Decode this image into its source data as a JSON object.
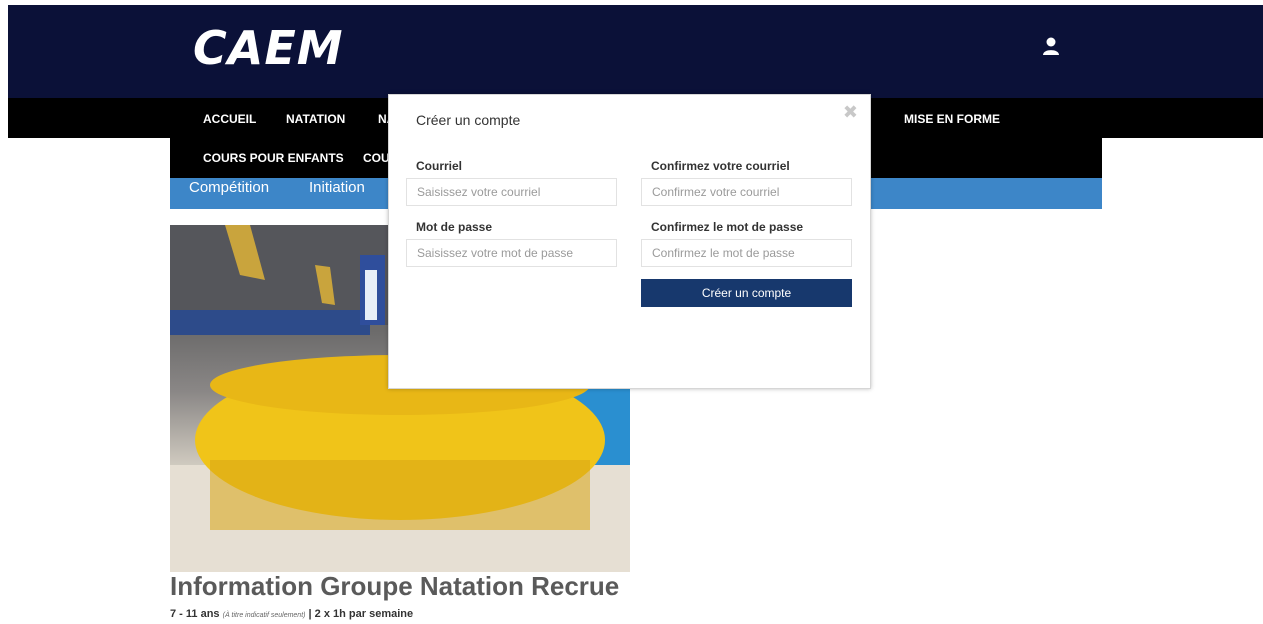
{
  "header": {
    "logo_text": "CAEM",
    "user_icon": "user-icon"
  },
  "nav": {
    "row1": [
      "ACCUEIL",
      "NATATION",
      "NA",
      "MISE EN FORME"
    ],
    "row2": [
      "COURS POUR ENFANTS",
      "COU"
    ]
  },
  "subnav": [
    "Compétition",
    "Initiation"
  ],
  "modal": {
    "title": "Créer un compte",
    "close_icon": "close-icon",
    "email_label": "Courriel",
    "email_placeholder": "Saisissez votre courriel",
    "confirm_email_label": "Confirmez votre courriel",
    "confirm_email_placeholder": "Confirmez votre courriel",
    "password_label": "Mot de passe",
    "password_placeholder": "Saisissez votre mot de passe",
    "confirm_password_label": "Confirmez le mot de passe",
    "confirm_password_placeholder": "Confirmez le mot de passe",
    "submit_label": "Créer un compte"
  },
  "content": {
    "heading": "Information Groupe Natation Recrue",
    "age": "7 - 11 ans",
    "age_note": "(À titre indicatif seulement)",
    "schedule": "| 2 x 1h par semaine"
  },
  "colors": {
    "header_bg": "#0b1138",
    "nav_bg": "#000000",
    "subnav_bg": "#3d86c8",
    "button_bg": "#17386d"
  }
}
